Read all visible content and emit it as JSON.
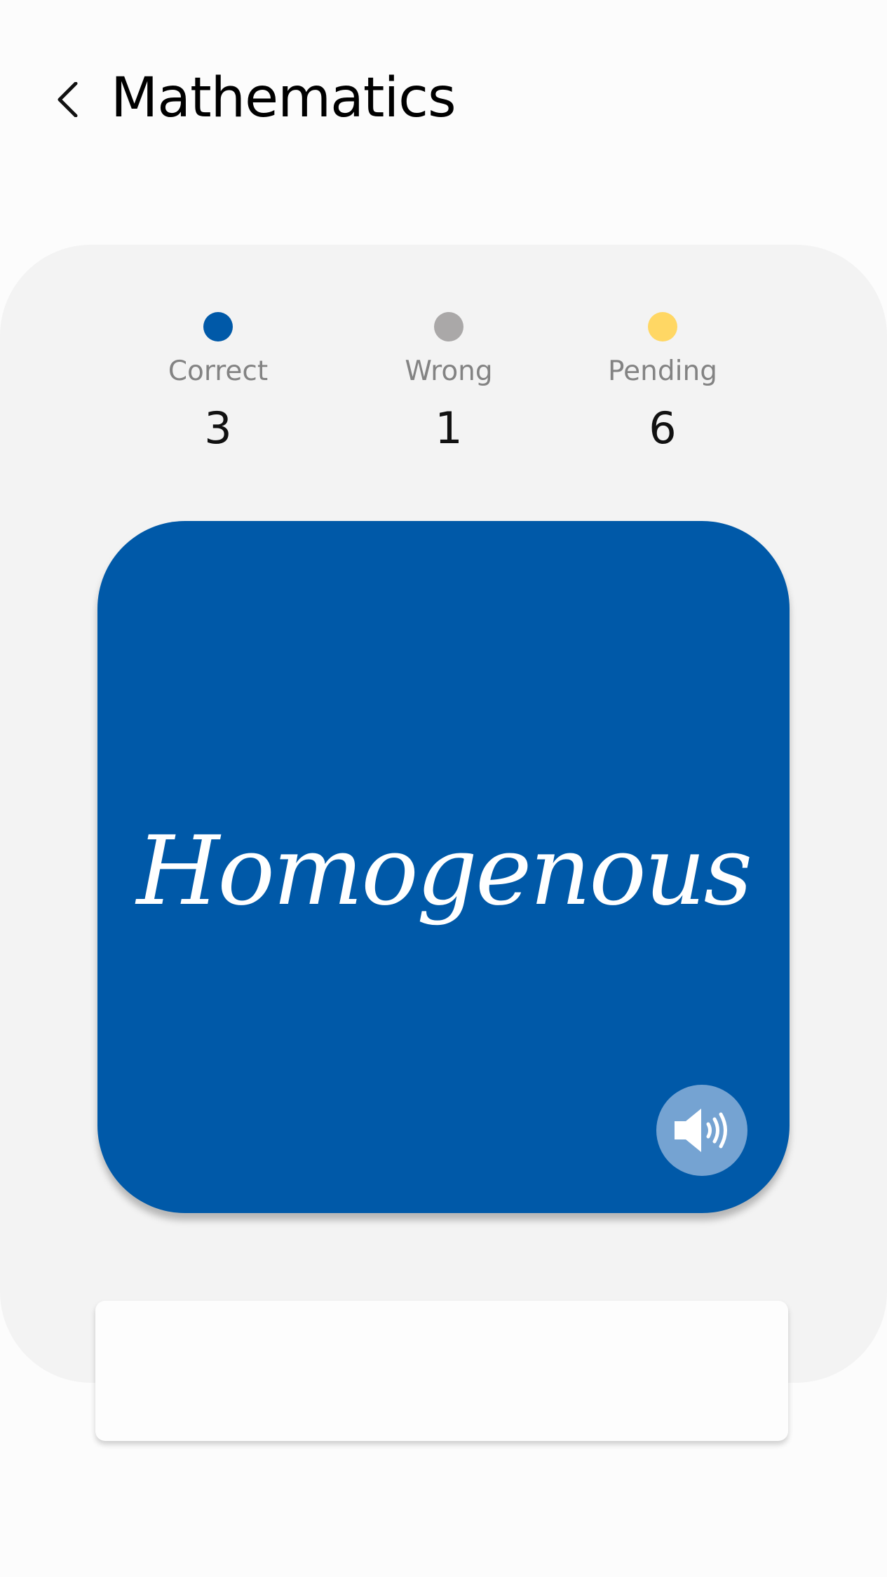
{
  "header": {
    "back_icon": "chevron-left-icon",
    "title": "Mathematics"
  },
  "stats": [
    {
      "label": "Correct",
      "count": "3",
      "color": "#0059a8"
    },
    {
      "label": "Wrong",
      "count": "1",
      "color": "#aaa8a8"
    },
    {
      "label": "Pending",
      "count": "6",
      "color": "#ffd764"
    }
  ],
  "card": {
    "word": "Homogenous",
    "background": "#0059a8",
    "audio_icon": "speaker-icon"
  },
  "answer_panel": {
    "text": ""
  }
}
